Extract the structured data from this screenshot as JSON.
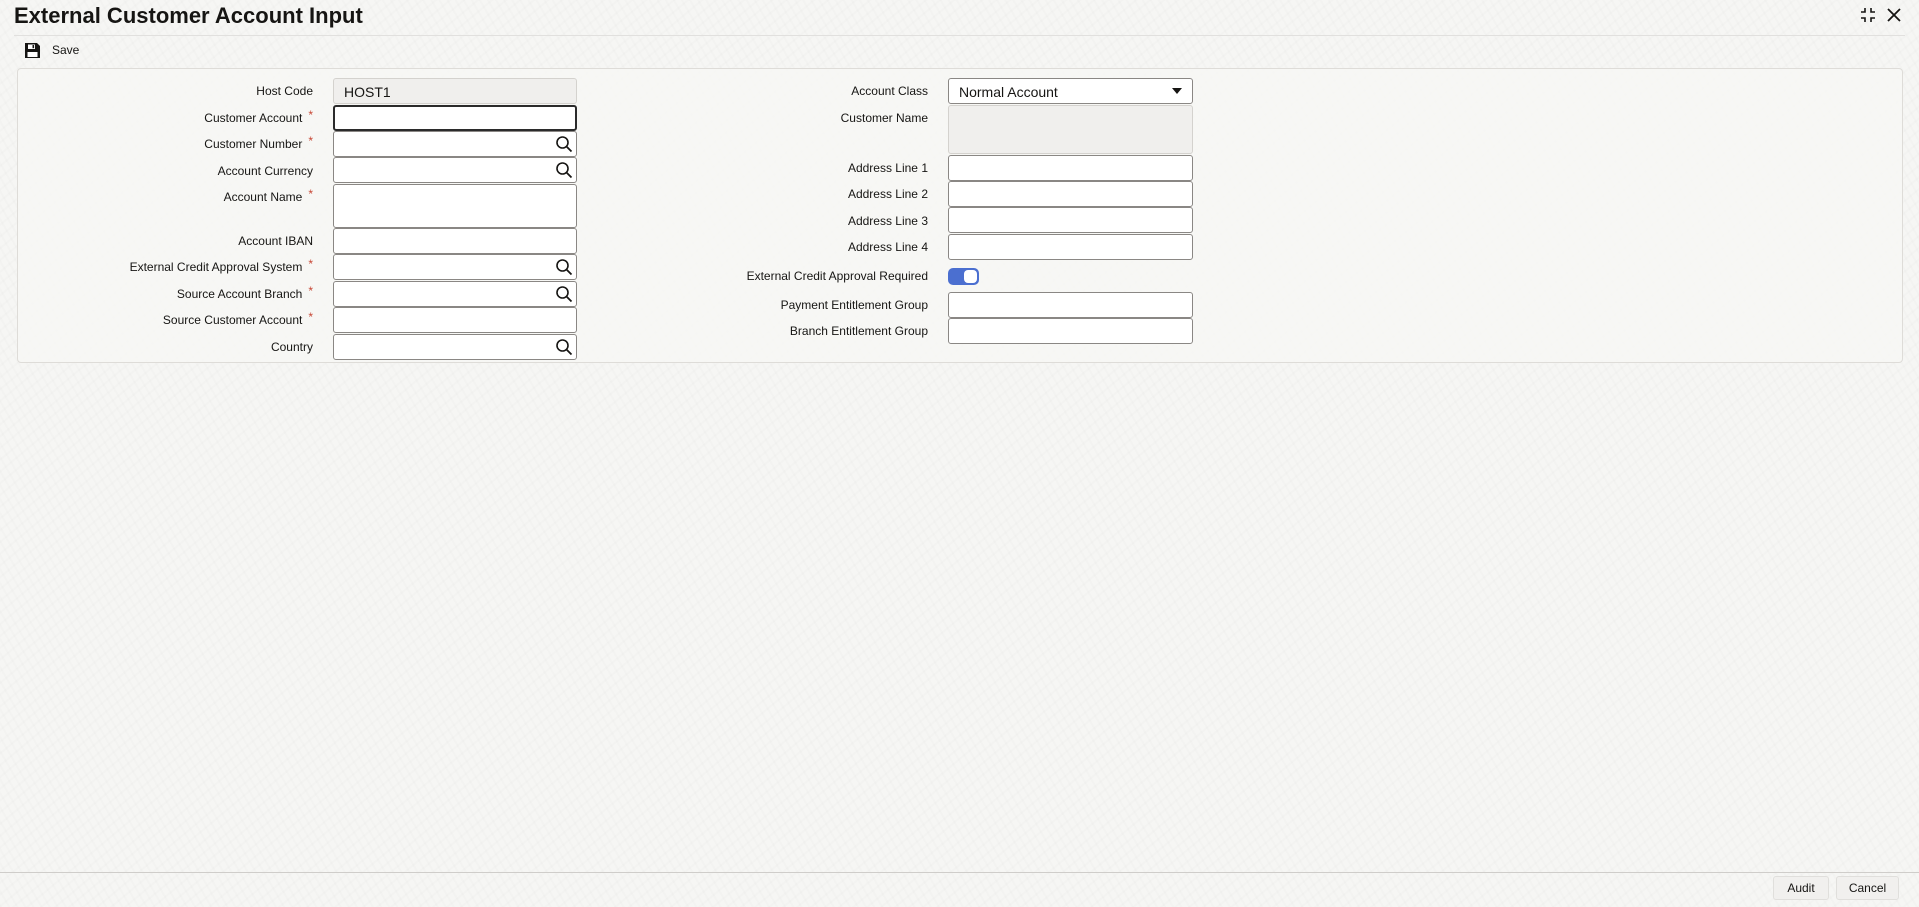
{
  "header": {
    "title": "External Customer Account Input"
  },
  "toolbar": {
    "save_label": "Save"
  },
  "form": {
    "left": {
      "host_code": {
        "label": "Host Code",
        "value": "HOST1"
      },
      "customer_account": {
        "label": "Customer Account",
        "value": ""
      },
      "customer_number": {
        "label": "Customer Number",
        "value": ""
      },
      "account_currency": {
        "label": "Account Currency",
        "value": ""
      },
      "account_name": {
        "label": "Account Name",
        "value": ""
      },
      "account_iban": {
        "label": "Account IBAN",
        "value": ""
      },
      "external_credit_approval_system": {
        "label": "External Credit Approval System",
        "value": ""
      },
      "source_account_branch": {
        "label": "Source Account Branch",
        "value": ""
      },
      "source_customer_account": {
        "label": "Source Customer Account",
        "value": ""
      },
      "country": {
        "label": "Country",
        "value": ""
      }
    },
    "right": {
      "account_class": {
        "label": "Account Class",
        "value": "Normal Account"
      },
      "customer_name": {
        "label": "Customer Name",
        "value": ""
      },
      "address_line_1": {
        "label": "Address Line 1",
        "value": ""
      },
      "address_line_2": {
        "label": "Address Line 2",
        "value": ""
      },
      "address_line_3": {
        "label": "Address Line 3",
        "value": ""
      },
      "address_line_4": {
        "label": "Address Line 4",
        "value": ""
      },
      "external_credit_approval_required": {
        "label": "External Credit Approval Required",
        "on": true
      },
      "payment_entitlement_group": {
        "label": "Payment Entitlement Group",
        "value": ""
      },
      "branch_entitlement_group": {
        "label": "Branch Entitlement Group",
        "value": ""
      }
    },
    "required_marker": "*"
  },
  "footer": {
    "audit_label": "Audit",
    "cancel_label": "Cancel"
  },
  "colors": {
    "accent": "#4b6fd0",
    "required": "#c74634",
    "text": "#161513"
  },
  "icons": {
    "save": "save-icon",
    "lookup": "search-icon",
    "minimize": "collapse-icon",
    "close": "close-icon",
    "dropdown": "chevron-down-icon"
  }
}
